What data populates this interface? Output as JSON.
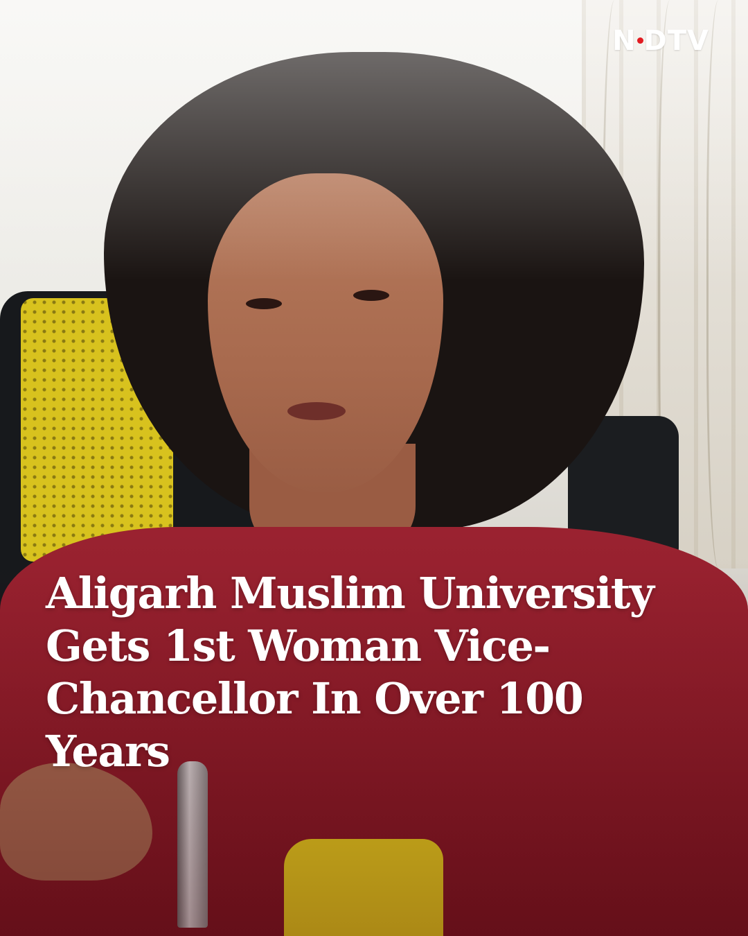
{
  "logo": {
    "prefix": "N",
    "suffix": "DTV",
    "accent_color": "#e21b22"
  },
  "headline": {
    "lines": [
      "Aligarh Muslim University",
      "Gets 1st Woman Vice-",
      "Chancellor In Over 100",
      "Years"
    ]
  },
  "colors": {
    "shirt": "#8e1d2a",
    "text": "#ffffff"
  }
}
